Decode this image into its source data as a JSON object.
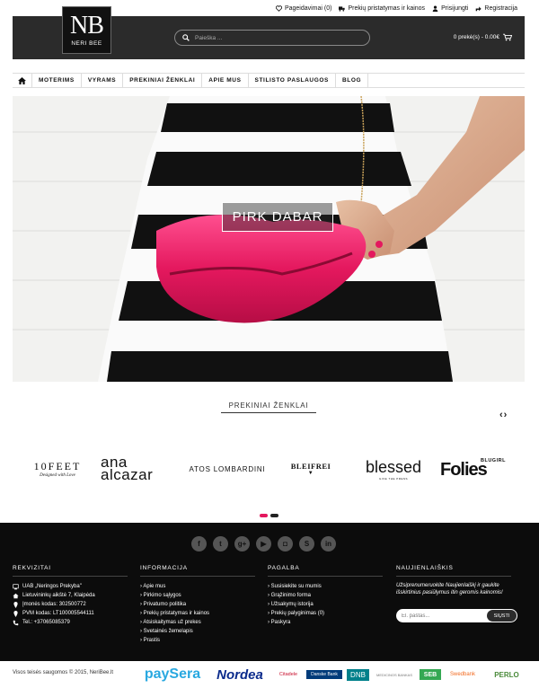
{
  "toplinks": {
    "wishlist": "Pageidavimai (0)",
    "shipping": "Prekių pristatymas ir kainos",
    "login": "Prisijungti",
    "register": "Registracija"
  },
  "logo": {
    "mark": "NB",
    "text": "NERI BEE"
  },
  "search": {
    "placeholder": "Paieška ..."
  },
  "cart": {
    "label": "0 prekė(s) - 0.00€"
  },
  "nav": [
    "MOTERIMS",
    "VYRAMS",
    "PREKINIAI ŽENKLAI",
    "APIE MUS",
    "STILISTO PASLAUGOS",
    "BLOG"
  ],
  "hero": {
    "cta": "PIRK DABAR"
  },
  "brands": {
    "title": "PREKINIAI ŽENKLAI",
    "prev": "‹",
    "next": "›",
    "items": [
      {
        "name": "10FEET",
        "sub": "Designed with Love"
      },
      {
        "name": "ana",
        "name2": "alcazar"
      },
      {
        "name": "ATOS LOMBARDINI"
      },
      {
        "name": "BLEIFREI",
        "sub": "▼"
      },
      {
        "name": "blessed",
        "sub": "GIVE THE PRESS"
      },
      {
        "name": "Folies",
        "sub": "BLUGIRL"
      }
    ]
  },
  "socials": [
    "f",
    "t",
    "g+",
    "▶",
    "◘",
    "S",
    "in"
  ],
  "footer": {
    "rekvizitai": {
      "title": "REKVIZITAI",
      "lines": [
        "UAB „Neringos Prekyba\"",
        "Lietuvininkų aikštė 7, Klaipėda",
        "Įmonės kodas: 302500772",
        "PVM kodas: LT100005544111",
        "Tel.: +37065085379"
      ]
    },
    "informacija": {
      "title": "INFORMACIJA",
      "links": [
        "Apie mus",
        "Pirkimo sąlygos",
        "Privatumo politika",
        "Prekių pristatymas ir kainos",
        "Atsiskaitymas už prekes",
        "Svetainės žemelapis",
        "Prastis"
      ]
    },
    "pagalba": {
      "title": "PAGALBA",
      "links": [
        "Susisiekite su mumis",
        "Grąžinimo forma",
        "Užsakymų istorija",
        "Prekių palyginimas (0)",
        "Paskyra"
      ]
    },
    "naujienlaiskis": {
      "title": "NAUJIENLAIŠKIS",
      "text": "Užsiprenumeruokite Naujienlaiškį ir gaukite išskirtinius pasiūlymus itin geromis kainomis!",
      "placeholder": "El. paštas...",
      "button": "SIŲSTI"
    }
  },
  "bottom": {
    "copyright": "Visos teisės saugomos © 2015, NeriBee.lt",
    "payments": [
      "paySera",
      "Nordea",
      "Citadele",
      "Danske Bank",
      "DNB",
      "MEDICINOS BANKAS",
      "SEB",
      "Swedbank",
      "PERLO"
    ]
  },
  "colors": {
    "accent": "#e4185e",
    "dark": "#2b2b2b",
    "footer": "#0c0c0c"
  }
}
